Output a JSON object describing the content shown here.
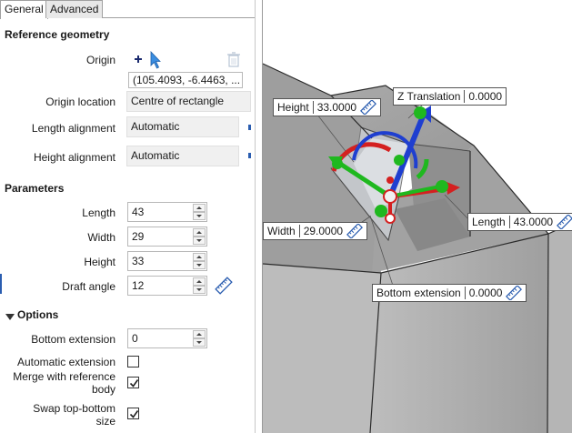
{
  "tabs": [
    {
      "label": "General",
      "active": true
    },
    {
      "label": "Advanced",
      "active": false
    }
  ],
  "reference_geometry": {
    "title": "Reference geometry",
    "origin_label": "Origin",
    "origin_value": "(105.4093, -6.4463, ...",
    "origin_location_label": "Origin location",
    "origin_location_value": "Centre of rectangle",
    "length_alignment_label": "Length alignment",
    "length_alignment_value": "Automatic",
    "height_alignment_label": "Height alignment",
    "height_alignment_value": "Automatic"
  },
  "parameters": {
    "title": "Parameters",
    "length_label": "Length",
    "length_value": "43",
    "width_label": "Width",
    "width_value": "29",
    "height_label": "Height",
    "height_value": "33",
    "draft_label": "Draft angle",
    "draft_value": "12"
  },
  "options": {
    "title": "Options",
    "bottom_ext_label": "Bottom extension",
    "bottom_ext_value": "0",
    "auto_ext_label": "Automatic extension",
    "auto_ext_checked": false,
    "merge_label_1": "Merge with reference",
    "merge_label_2": "body",
    "merge_checked": true,
    "swap_label_1": "Swap top-bottom",
    "swap_label_2": "size",
    "swap_checked": true
  },
  "viewport_labels": {
    "height": {
      "name": "Height",
      "value": "33.0000"
    },
    "z_translation": {
      "name": "Z Translation",
      "value": "0.0000"
    },
    "width": {
      "name": "Width",
      "value": "29.0000"
    },
    "length": {
      "name": "Length",
      "value": "43.0000"
    },
    "bottom_extension": {
      "name": "Bottom extension",
      "value": "0.0000"
    }
  },
  "colors": {
    "accent_blue": "#2a5db0",
    "gizmo_red": "#d42020",
    "gizmo_green": "#1fb81f",
    "gizmo_blue": "#1f3fd0",
    "solid_face": "#a8a8a8"
  }
}
